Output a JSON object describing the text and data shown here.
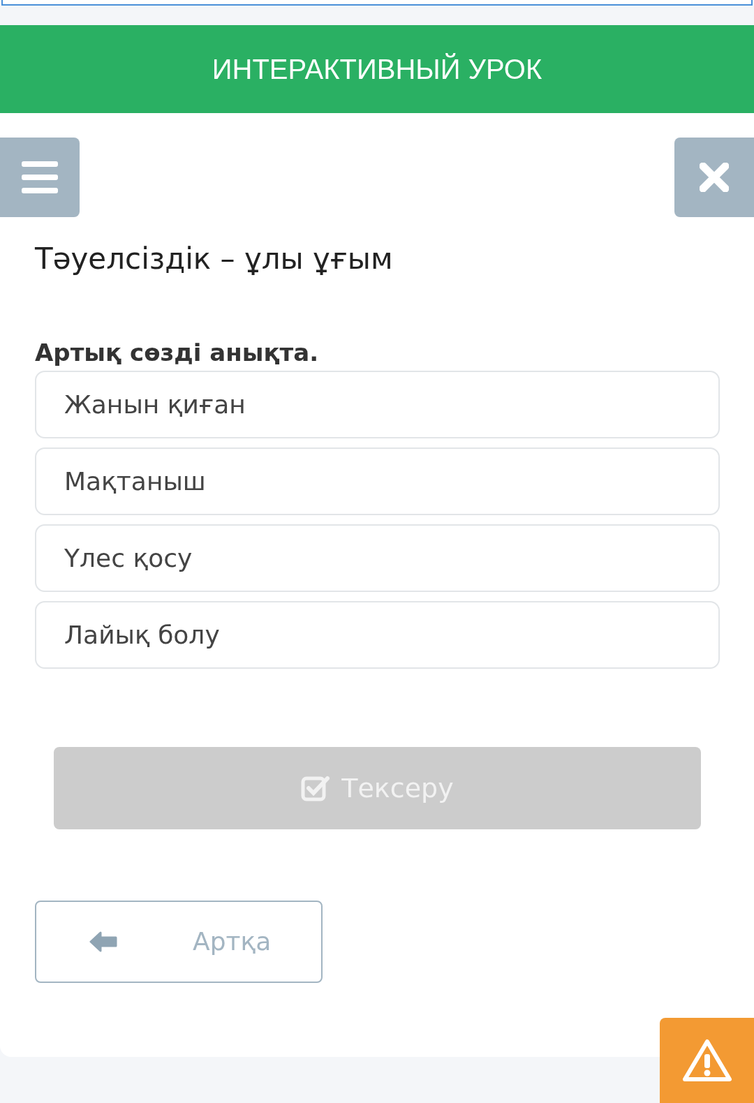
{
  "header": {
    "title": "ИНТЕРАКТИВНЫЙ УРОК"
  },
  "lesson_title": "Тәуелсіздік – ұлы ұғым",
  "question": "Артық сөзді анықта.",
  "options": [
    {
      "label": "Жанын қиған",
      "selected": false
    },
    {
      "label": "Мақтаныш",
      "selected": false
    },
    {
      "label": "Үлес қосу",
      "selected": false
    },
    {
      "label": "Лайық болу",
      "selected": false
    }
  ],
  "check_button": {
    "label": "Тексеру",
    "disabled": true
  },
  "back_button": {
    "label": "Артқа"
  }
}
